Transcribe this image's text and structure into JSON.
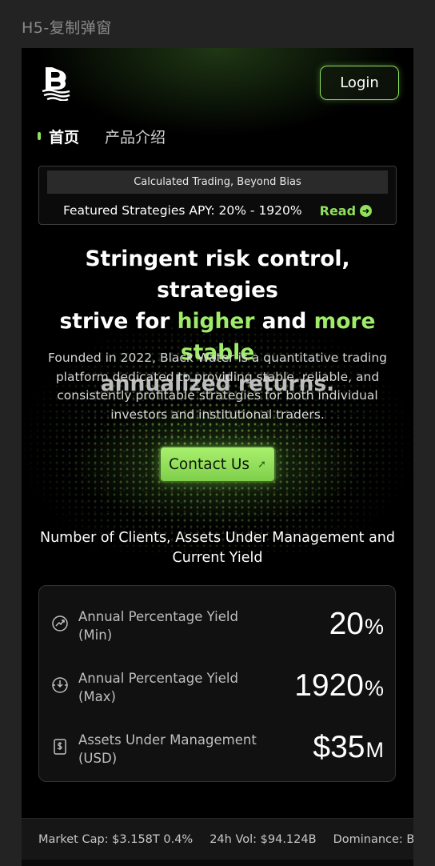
{
  "frame_label": "H5-复制弹窗",
  "header": {
    "login_label": "Login"
  },
  "nav": {
    "items": [
      "首页",
      "产品介绍"
    ]
  },
  "banner": {
    "tagline": "Calculated Trading, Beyond Bias",
    "apy_text": "Featured Strategies APY: 20% - 1920%",
    "read_label": "Read"
  },
  "hero": {
    "line1": "Stringent risk control, strategies",
    "line2_a": "strive for ",
    "line2_b": "higher",
    "line2_c": " and ",
    "line2_d": "more stable",
    "line3": "annualized returns.",
    "description": "Founded in 2022, Black Water is a quantitative trading platform dedicated to providing stable, reliable, and consistently profitable strategies for both individual investors and institutional traders.",
    "contact_label": "Contact Us"
  },
  "stats": {
    "title": "Number of Clients, Assets Under Management and Current Yield",
    "rows": [
      {
        "label": "Annual Percentage Yield (Min)",
        "value": "20",
        "unit": "%",
        "icon": "trend-circle-icon"
      },
      {
        "label": "Annual Percentage Yield (Max)",
        "value": "1920",
        "unit": "%",
        "icon": "target-circle-icon"
      },
      {
        "label": "Assets Under Management (USD)",
        "value": "$35",
        "unit": "M",
        "icon": "wallet-dollar-icon"
      }
    ]
  },
  "ticker": {
    "market_cap": "Market Cap: $3.158T 0.4%",
    "volume": "24h Vol: $94.124B",
    "dominance": "Dominance: B"
  },
  "colors": {
    "accent": "#8fe05a",
    "background": "#000000"
  }
}
